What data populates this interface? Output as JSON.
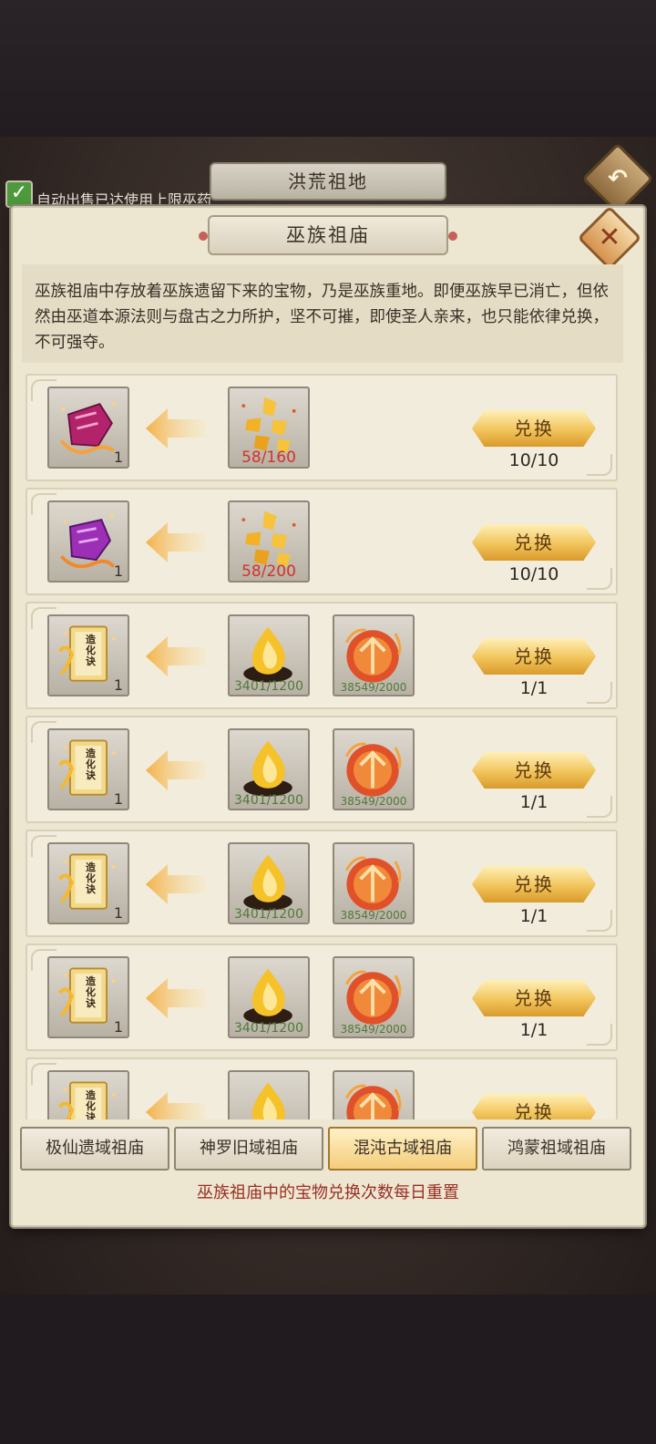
{
  "underlying": {
    "title": "洪荒祖地",
    "auto_sell_label": "自动出售已达使用上限巫药",
    "auto_sell_checked": true
  },
  "panel": {
    "title": "巫族祖庙",
    "description": "巫族祖庙中存放着巫族遗留下来的宝物，乃是巫族重地。即便巫族早已消亡，但依然由巫道本源法则与盘古之力所护，坚不可摧，即使圣人亲来，也只能依律兑换，不可强夺。"
  },
  "exchange_label": "兑换",
  "rows": [
    {
      "reward": {
        "icon": "purple-red-token-icon",
        "count": "1"
      },
      "costs": [
        {
          "icon": "gold-shards-icon",
          "req": "58/160",
          "insufficient": true
        }
      ],
      "limit": "10/10"
    },
    {
      "reward": {
        "icon": "purple-token-icon",
        "count": "1"
      },
      "costs": [
        {
          "icon": "gold-shards-icon",
          "req": "58/200",
          "insufficient": true
        }
      ],
      "limit": "10/10"
    },
    {
      "reward": {
        "icon": "scroll-book-icon",
        "count": "1"
      },
      "costs": [
        {
          "icon": "golden-flame-icon",
          "req": "3401/1200",
          "insufficient": false
        },
        {
          "icon": "fire-orb-icon",
          "req": "38549/2000",
          "insufficient": false
        }
      ],
      "limit": "1/1"
    },
    {
      "reward": {
        "icon": "scroll-book-icon",
        "count": "1"
      },
      "costs": [
        {
          "icon": "golden-flame-icon",
          "req": "3401/1200",
          "insufficient": false
        },
        {
          "icon": "fire-orb-icon",
          "req": "38549/2000",
          "insufficient": false
        }
      ],
      "limit": "1/1"
    },
    {
      "reward": {
        "icon": "scroll-book-icon",
        "count": "1"
      },
      "costs": [
        {
          "icon": "golden-flame-icon",
          "req": "3401/1200",
          "insufficient": false
        },
        {
          "icon": "fire-orb-icon",
          "req": "38549/2000",
          "insufficient": false
        }
      ],
      "limit": "1/1"
    },
    {
      "reward": {
        "icon": "scroll-book-icon",
        "count": "1"
      },
      "costs": [
        {
          "icon": "golden-flame-icon",
          "req": "3401/1200",
          "insufficient": false
        },
        {
          "icon": "fire-orb-icon",
          "req": "38549/2000",
          "insufficient": false
        }
      ],
      "limit": "1/1"
    },
    {
      "reward": {
        "icon": "scroll-book-icon",
        "count": ""
      },
      "costs": [
        {
          "icon": "golden-flame-icon",
          "req": "",
          "insufficient": false
        },
        {
          "icon": "fire-orb-icon",
          "req": "",
          "insufficient": false
        }
      ],
      "limit": ""
    }
  ],
  "scroll_text": "造化诀",
  "tabs": [
    {
      "label": "极仙遗域祖庙",
      "active": false
    },
    {
      "label": "神罗旧域祖庙",
      "active": false
    },
    {
      "label": "混沌古域祖庙",
      "active": true
    },
    {
      "label": "鸿蒙祖域祖庙",
      "active": false
    }
  ],
  "reset_note": "巫族祖庙中的宝物兑换次数每日重置",
  "colors": {
    "insufficient": "#d3322a",
    "sufficient": "#4f7a3a",
    "exchange_button": "#f1c45a"
  }
}
